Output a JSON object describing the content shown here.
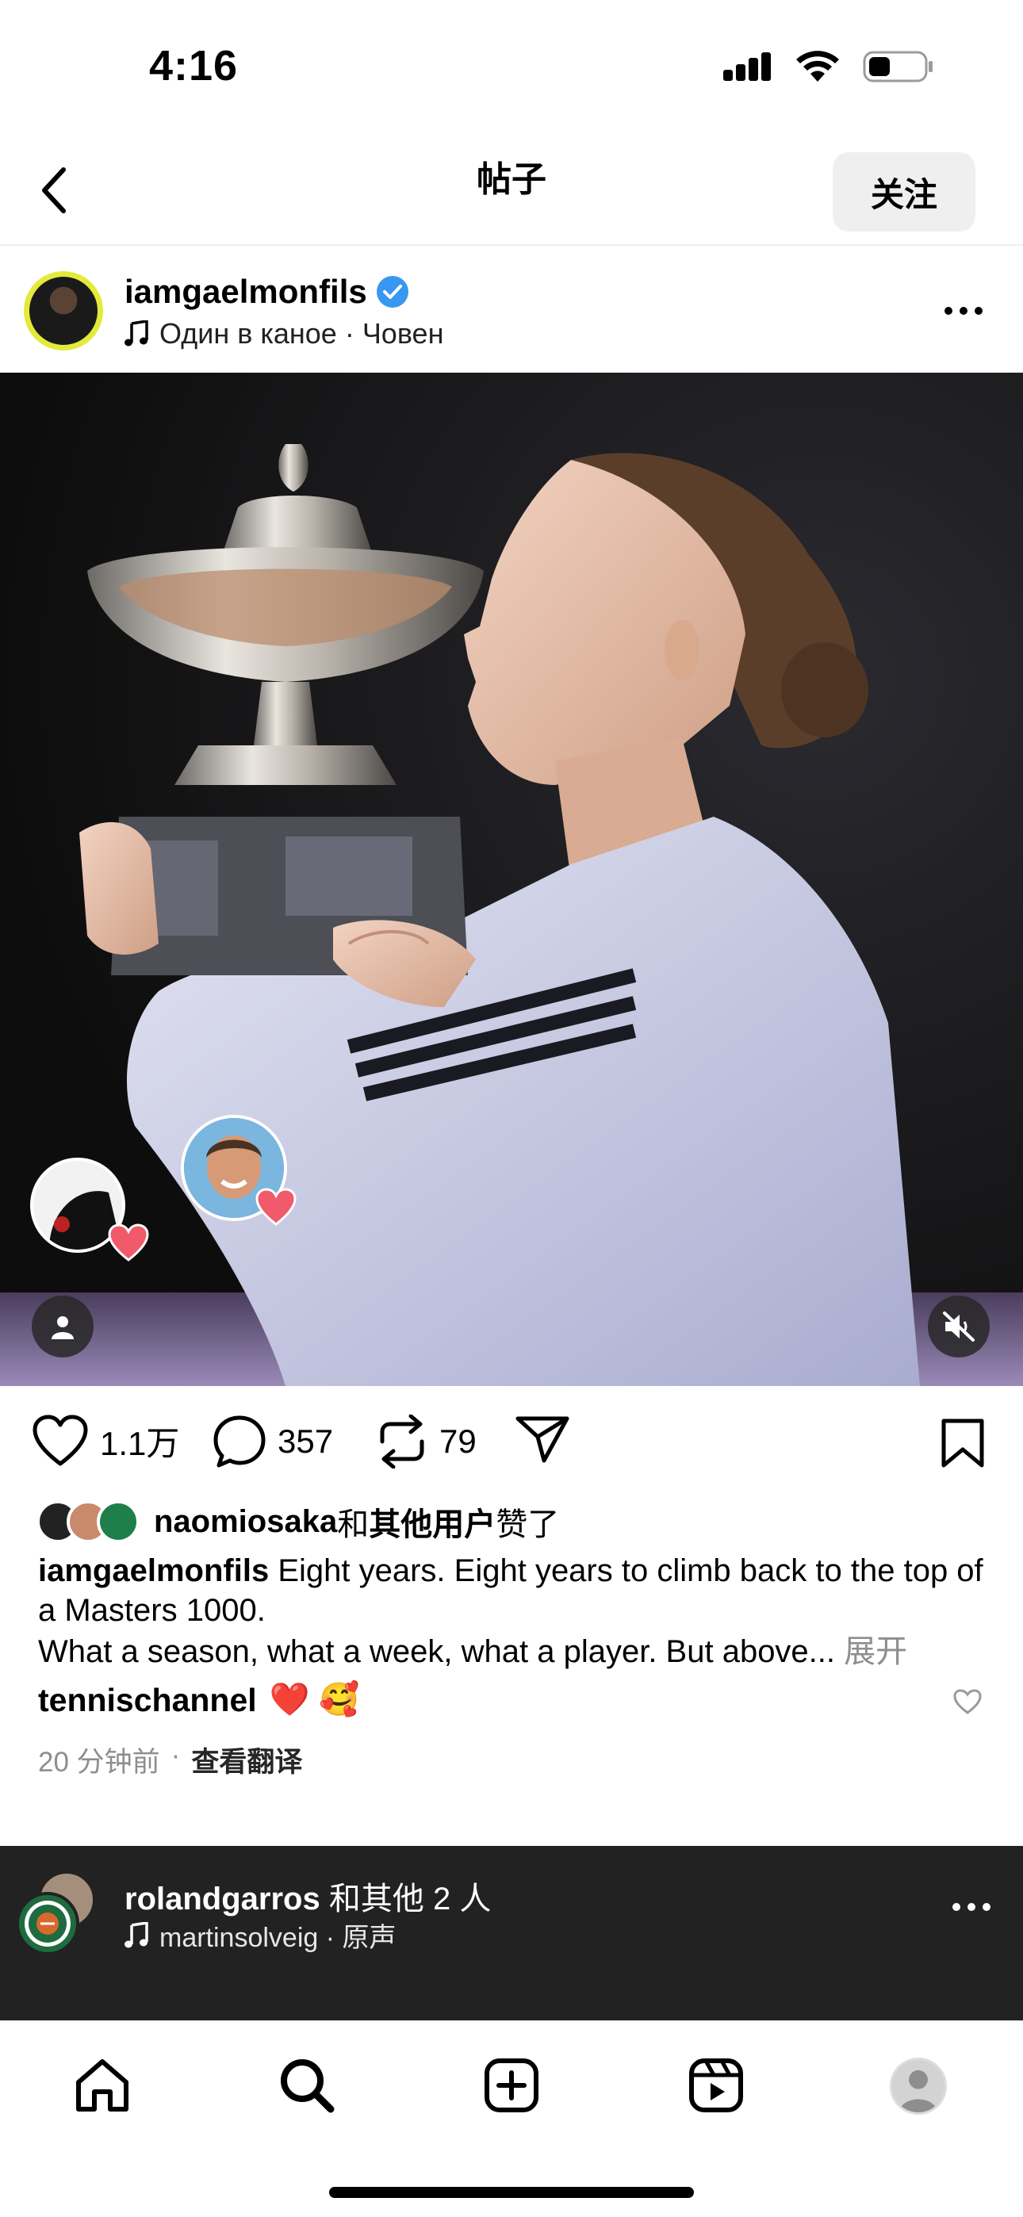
{
  "status_bar": {
    "time": "4:16",
    "icons": [
      "cellular-signal-icon",
      "wifi-icon",
      "battery-icon"
    ]
  },
  "header": {
    "title": "帖子",
    "follow_label": "关注",
    "back_icon": "chevron-left-icon"
  },
  "post": {
    "author": {
      "username": "iamgaelmonfils",
      "verified": true,
      "music": "Один в каное · Човен"
    },
    "photo": {
      "reactions": [
        "reaction-avatar-1",
        "reaction-avatar-2"
      ],
      "muted": true
    },
    "actions": {
      "likes": "1.1万",
      "comments": "357",
      "reposts": "79"
    },
    "liked_by": {
      "user": "naomiosaka",
      "connector": "和",
      "others": "其他用户",
      "suffix": "赞了"
    },
    "caption": {
      "username": "iamgaelmonfils",
      "line1": "Eight years. Eight years to climb back to the top of a Masters 1000.",
      "line2": "What a season, what a week, what a player. But above...",
      "more": "展开"
    },
    "top_comment": {
      "username": "tennischannel",
      "text": "❤️ 🥰"
    },
    "meta": {
      "time_ago": "20 分钟前",
      "separator": "·",
      "translate": "查看翻译"
    }
  },
  "next_post": {
    "username": "rolandgarros",
    "others": "和其他 2 人",
    "music": "martinsolveig · 原声"
  },
  "tab_bar": {
    "tabs": [
      "home-icon",
      "search-icon",
      "create-icon",
      "reels-icon",
      "profile-avatar"
    ]
  },
  "colors": {
    "verified": "#3897f0",
    "heart": "#e0245e",
    "dark_panel": "#222222"
  }
}
